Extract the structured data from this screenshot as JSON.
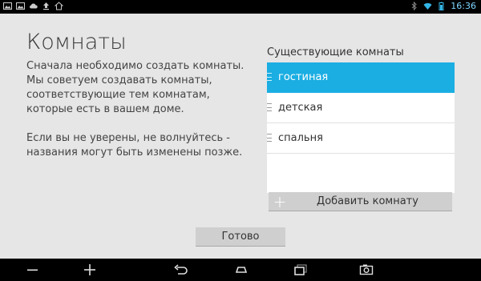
{
  "status_bar": {
    "time": "16:36",
    "left_icons": [
      "image-icon",
      "image-icon",
      "cloud-icon",
      "upload-icon",
      "home-icon"
    ],
    "right_icons": [
      "bluetooth-icon",
      "wifi-icon",
      "battery-icon"
    ]
  },
  "main": {
    "title": "Комнаты",
    "description_p1": "Сначала необходимо создать комнаты. Мы советуем создавать комнаты, соответствующие тем комнатам, которые есть в вашем доме.",
    "description_p2": "Если вы не уверены, не волнуйтесь - названия могут быть изменены позже."
  },
  "rooms": {
    "title": "Существующие комнаты",
    "items": [
      {
        "label": "гостиная",
        "selected": true
      },
      {
        "label": "детская",
        "selected": false
      },
      {
        "label": "спальня",
        "selected": false
      }
    ],
    "add_label": "Добавить комнату"
  },
  "done_label": "Готово",
  "nav_bar": {
    "icons": [
      "minus-icon",
      "plus-icon",
      "back-icon",
      "home-icon",
      "recent-apps-icon",
      "screenshot-icon"
    ]
  },
  "colors": {
    "accent": "#1aaee2",
    "background": "#e6e6e6",
    "status_text": "#6bd3ff"
  }
}
